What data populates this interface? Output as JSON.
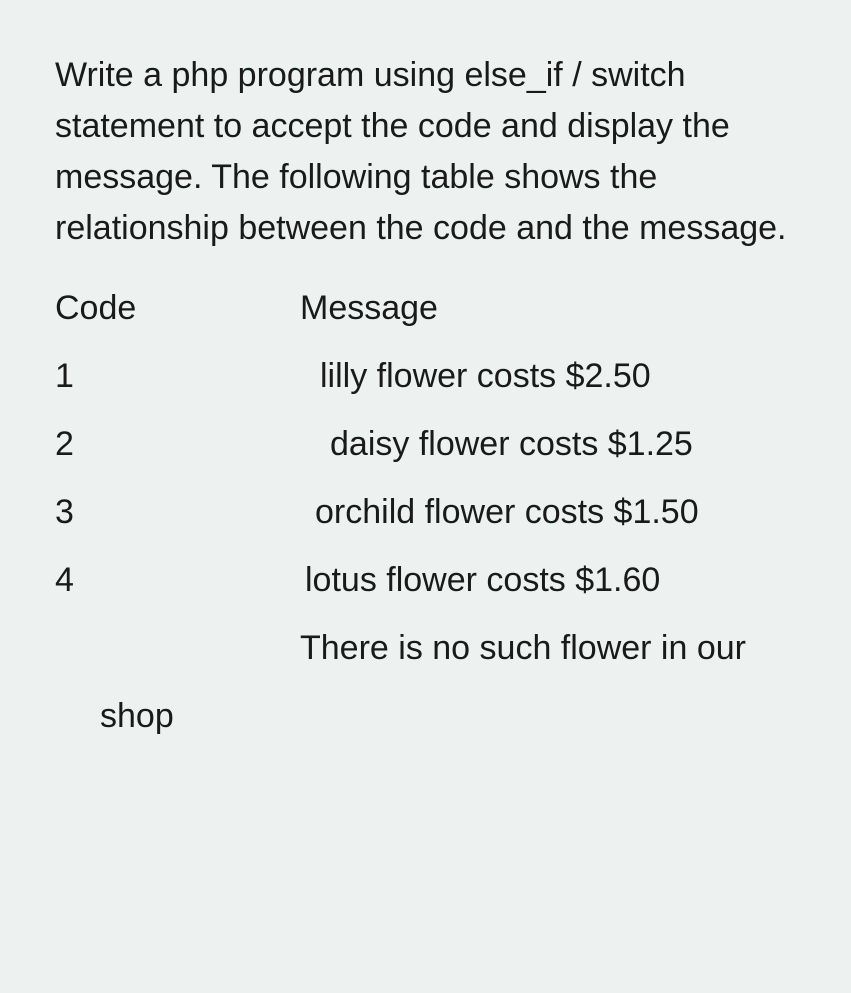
{
  "question": "Write a php program using else_if / switch statement to accept the code and display the message. The following table shows the relationship between the code and the message.",
  "headers": {
    "code": "Code",
    "message": "Message"
  },
  "rows": [
    {
      "code": "1",
      "message": "lilly flower costs $2.50"
    },
    {
      "code": "2",
      "message": "daisy flower costs $1.25"
    },
    {
      "code": "3",
      "message": "orchild flower costs $1.50"
    },
    {
      "code": "4",
      "message": "lotus flower costs $1.60"
    }
  ],
  "default_message": "There is no such flower in our",
  "default_wrap": "shop"
}
